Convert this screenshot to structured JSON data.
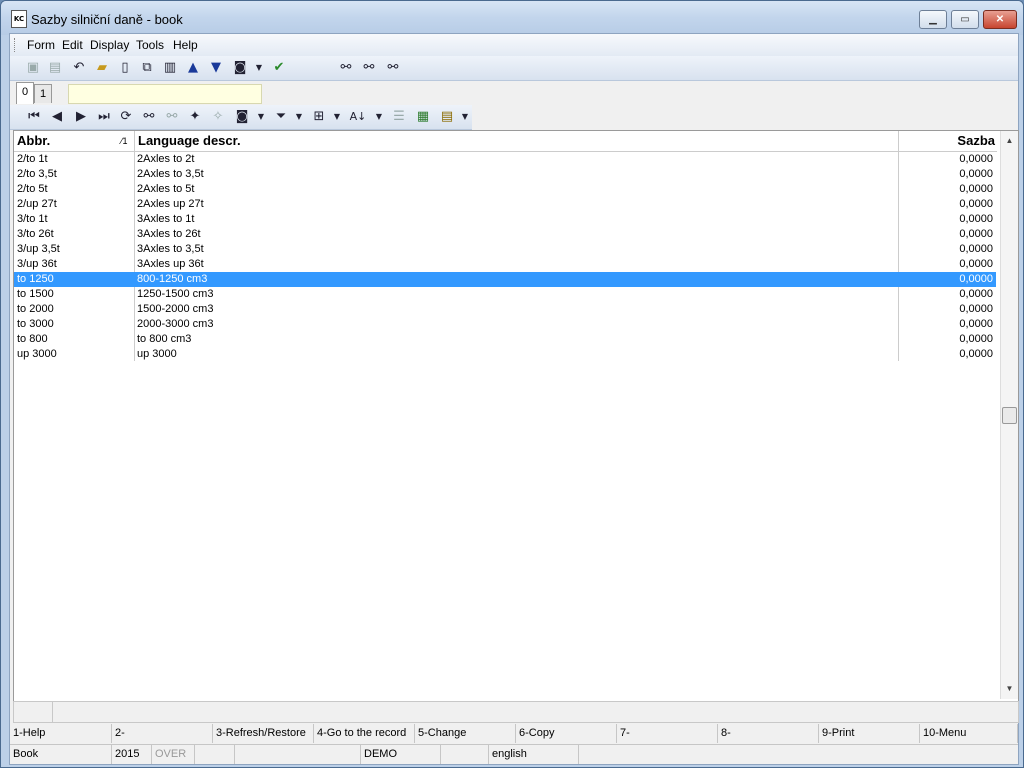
{
  "window": {
    "title": "Sazby silniční daně - book",
    "icon_text": "KC"
  },
  "menu": [
    "Form",
    "Edit",
    "Display",
    "Tools",
    "Help"
  ],
  "tabs": [
    "0",
    "1"
  ],
  "grid": {
    "columns": {
      "abbr": "Abbr.",
      "sort_indicator": "⁄1",
      "descr": "Language descr.",
      "rate": "Sazba"
    },
    "rows": [
      {
        "abbr": "2/to 1t",
        "descr": "2Axles to 2t",
        "rate": "0,0000"
      },
      {
        "abbr": "2/to 3,5t",
        "descr": "2Axles to 3,5t",
        "rate": "0,0000"
      },
      {
        "abbr": "2/to 5t",
        "descr": "2Axles to 5t",
        "rate": "0,0000"
      },
      {
        "abbr": "2/up 27t",
        "descr": "2Axles up 27t",
        "rate": "0,0000"
      },
      {
        "abbr": "3/to 1t",
        "descr": "3Axles to 1t",
        "rate": "0,0000"
      },
      {
        "abbr": "3/to 26t",
        "descr": "3Axles to 26t",
        "rate": "0,0000"
      },
      {
        "abbr": "3/up 3,5t",
        "descr": "3Axles to 3,5t",
        "rate": "0,0000"
      },
      {
        "abbr": "3/up 36t",
        "descr": "3Axles up 36t",
        "rate": "0,0000"
      },
      {
        "abbr": "to 1250",
        "descr": "800-1250 cm3",
        "rate": "0,0000",
        "selected": true
      },
      {
        "abbr": "to 1500",
        "descr": "1250-1500 cm3",
        "rate": "0,0000"
      },
      {
        "abbr": "to 2000",
        "descr": "1500-2000 cm3",
        "rate": "0,0000"
      },
      {
        "abbr": "to 3000",
        "descr": "2000-3000 cm3",
        "rate": "0,0000"
      },
      {
        "abbr": "to 800",
        "descr": "to 800 cm3",
        "rate": "0,0000"
      },
      {
        "abbr": "up 3000",
        "descr": "up 3000",
        "rate": "0,0000"
      }
    ]
  },
  "function_keys": [
    "1-Help",
    "2-",
    "3-Refresh/Restore",
    "4-Go to the record",
    "5-Change",
    "6-Copy",
    "7-",
    "8-",
    "9-Print",
    "10-Menu"
  ],
  "status": {
    "book": "Book",
    "year": "2015",
    "mode": "OVER",
    "demo": "DEMO",
    "language": "english"
  },
  "colors": {
    "selection": "#3399ff",
    "titlebar": "#c2d5ec",
    "close_button": "#c7452f"
  }
}
